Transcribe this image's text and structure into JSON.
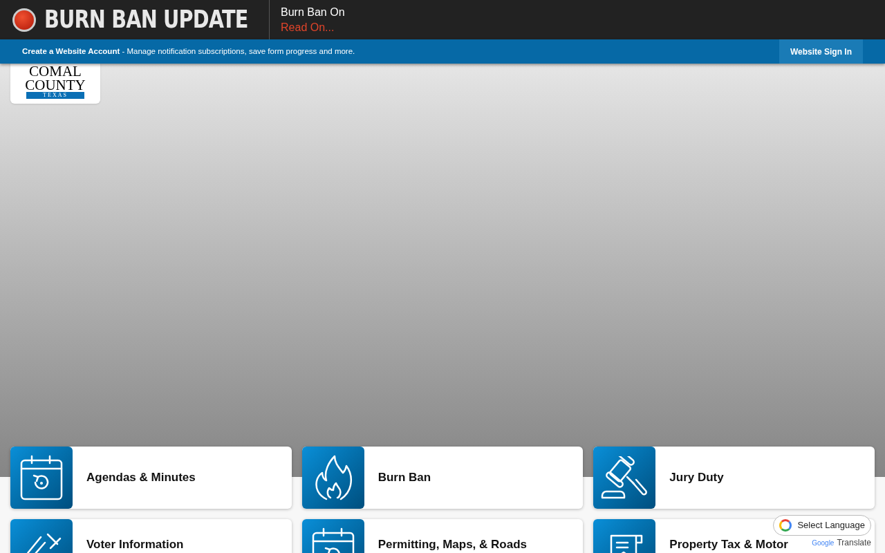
{
  "alert": {
    "title": "BURN BAN UPDATE",
    "headline": "Burn Ban On",
    "link": "Read On..."
  },
  "account_bar": {
    "link": "Create a Website Account",
    "text": " - Manage notification subscriptions, save form progress and more.",
    "sign_in": "Website Sign In"
  },
  "logo": {
    "line_1": "COMAL",
    "line_2": "COUNTY",
    "line_3": "TEXAS"
  },
  "tiles": [
    {
      "label": "Agendas & Minutes",
      "kind": "calendar"
    },
    {
      "label": "Burn Ban",
      "kind": "flame"
    },
    {
      "label": "Jury Duty",
      "kind": "gavel"
    },
    {
      "label": "Voter Information",
      "kind": "ballot"
    },
    {
      "label": "Permitting, Maps, & Roads",
      "kind": "calendar"
    },
    {
      "label": "Property Tax & Motor",
      "kind": "tax"
    }
  ],
  "translate": {
    "select": "Select Language",
    "brand": "Google",
    "label": "Translate"
  }
}
